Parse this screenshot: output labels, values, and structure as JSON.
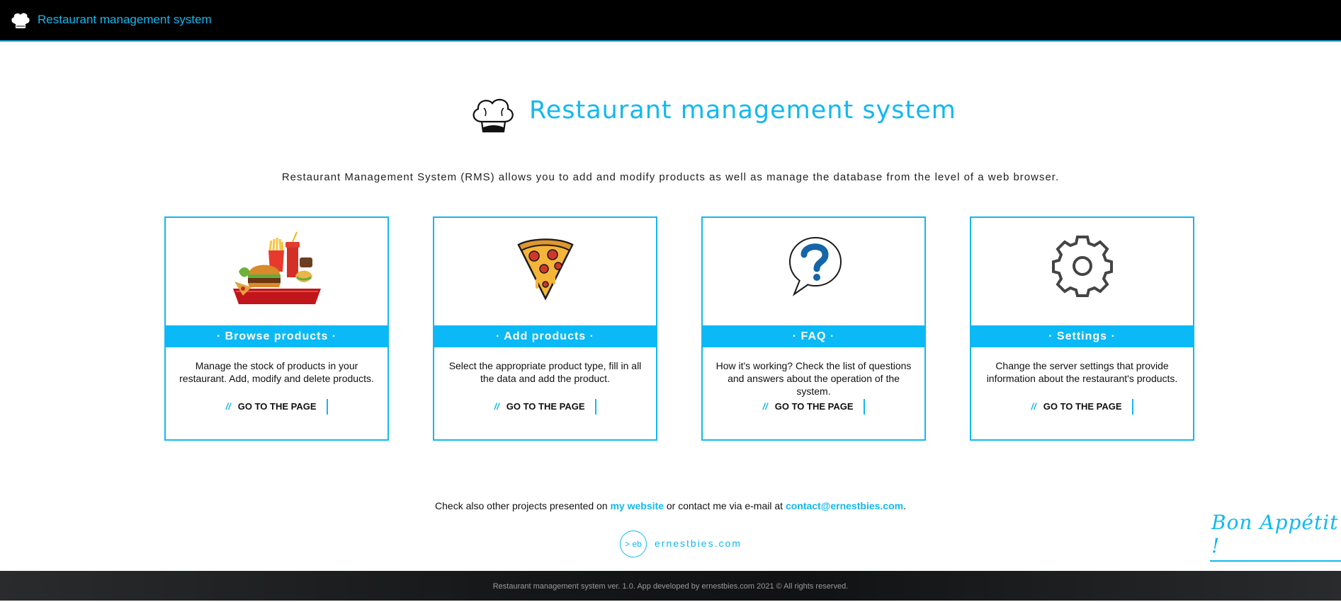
{
  "header": {
    "title": "Restaurant management system",
    "logo_icon": "chef-hat-icon"
  },
  "hero": {
    "title": "Restaurant management system",
    "intro": "Restaurant Management System (RMS) allows you to add and modify products as well as manage the database from the level of a web browser."
  },
  "cards": [
    {
      "title": "· Browse products ·",
      "description": "Manage the stock of products in your restaurant. Add, modify and delete products.",
      "link_prefix": "//",
      "link_label": "GO TO THE PAGE",
      "icon": "fast-food-tray-icon"
    },
    {
      "title": "· Add products ·",
      "description": "Select the appropriate product type, fill in all the data and add the product.",
      "link_prefix": "//",
      "link_label": "GO TO THE PAGE",
      "icon": "pizza-slice-icon"
    },
    {
      "title": "· FAQ ·",
      "description": "How it's working? Check the list of questions and answers about the operation of the system.",
      "link_prefix": "//",
      "link_label": "GO TO THE PAGE",
      "icon": "question-bubble-icon"
    },
    {
      "title": "· Settings ·",
      "description": "Change the server settings that provide information about the restaurant's products.",
      "link_prefix": "//",
      "link_label": "GO TO THE PAGE",
      "icon": "gear-icon"
    }
  ],
  "contact": {
    "prefix": "Check also other projects presented on ",
    "website_link": "my website",
    "middle": " or contact me via e-mail at ",
    "email": "contact@ernestbies.com",
    "suffix": "."
  },
  "brand": {
    "badge": "> eb",
    "site": "ernestbies.com"
  },
  "signature": "Bon Appétit !",
  "footer": {
    "text": "Restaurant management system ver. 1.0. App developed by ernestbies.com 2021 © All rights reserved."
  },
  "colors": {
    "accent": "#12b8f0",
    "band": "#0ab9f6",
    "topbar": "#000000",
    "footer": "#151618"
  }
}
